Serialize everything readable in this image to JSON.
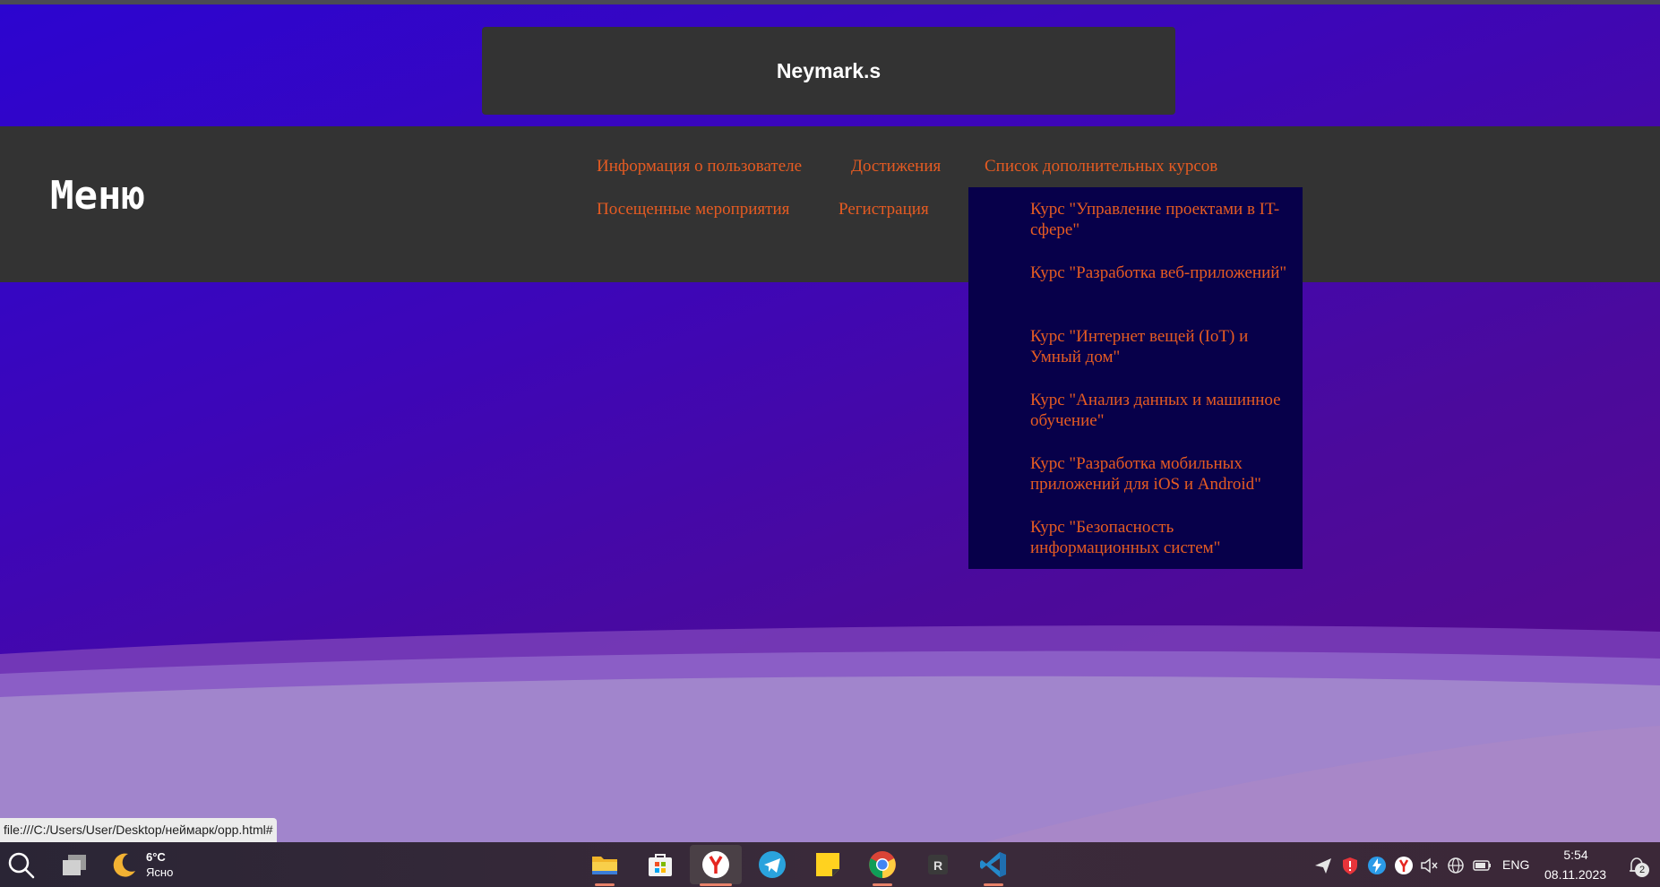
{
  "header": {
    "title": "Neymark.s"
  },
  "menu": {
    "title": "Меню",
    "links": [
      "Информация о пользователе",
      "Достижения",
      "Список дополнительных курсов",
      "Посещенные мероприятия",
      "Регистрация"
    ]
  },
  "dropdown": {
    "items": [
      "Курс \"Управление проектами в IT-сфере\"",
      "Курс \"Разработка веб-приложений\"",
      "Курс \"Интернет вещей (IoT) и Умный дом\"",
      "Курс \"Анализ данных и машинное обучение\"",
      "Курс \"Разработка мобильных приложений для iOS и Android\"",
      "Курс \"Безопасность информационных систем\""
    ]
  },
  "status_bar": {
    "url": "file:///C:/Users/User/Desktop/неймарк/opp.html#"
  },
  "taskbar": {
    "weather": {
      "temp": "6°C",
      "condition": "Ясно"
    },
    "pinned_apps": [
      "search-icon",
      "task-view-icon",
      "file-explorer-icon",
      "store-icon",
      "yandex-browser-icon",
      "telegram-icon",
      "sticky-notes-icon",
      "chrome-icon",
      "r-app-icon",
      "vscode-icon"
    ],
    "tray": {
      "language": "ENG",
      "time": "5:54",
      "date": "08.11.2023",
      "notifications": "2"
    }
  },
  "colors": {
    "link": "#e65b22",
    "menu_bg": "#333333",
    "dropdown_bg": "#07004a",
    "page_gradient_start": "#2c05d0",
    "page_gradient_end": "#5a0a8a"
  }
}
